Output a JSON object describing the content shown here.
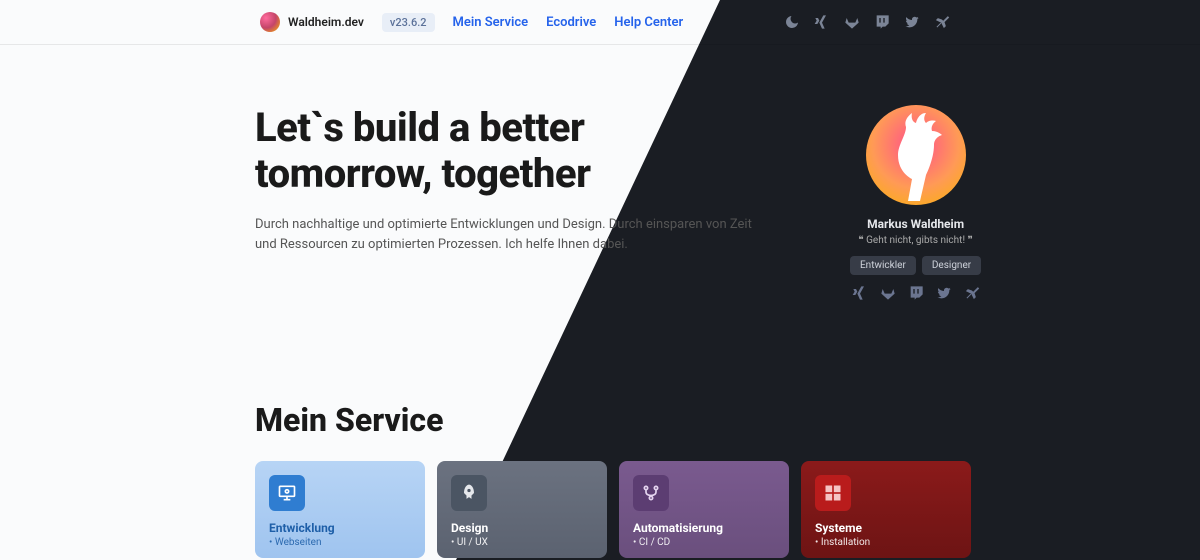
{
  "brand": {
    "name": "Waldheim.dev"
  },
  "version": "v23.6.2",
  "nav": [
    "Mein Service",
    "Ecodrive",
    "Help Center"
  ],
  "hero": {
    "title": "Let`s build a better tomorrow, together",
    "subtitle": "Durch nachhaltige und optimierte Entwicklungen und Design. Durch einsparen von Zeit und Ressourcen zu optimierten Prozessen. Ich helfe Ihnen dabei."
  },
  "profile": {
    "name": "Markus Waldheim",
    "quote": "Geht nicht, gibts nicht!",
    "badges": [
      "Entwickler",
      "Designer"
    ]
  },
  "sectionTitle": "Mein Service",
  "cards": [
    {
      "title": "Entwicklung",
      "item": "Webseiten"
    },
    {
      "title": "Design",
      "item": "UI / UX"
    },
    {
      "title": "Automatisierung",
      "item": "CI / CD"
    },
    {
      "title": "Systeme",
      "item": "Installation"
    }
  ]
}
